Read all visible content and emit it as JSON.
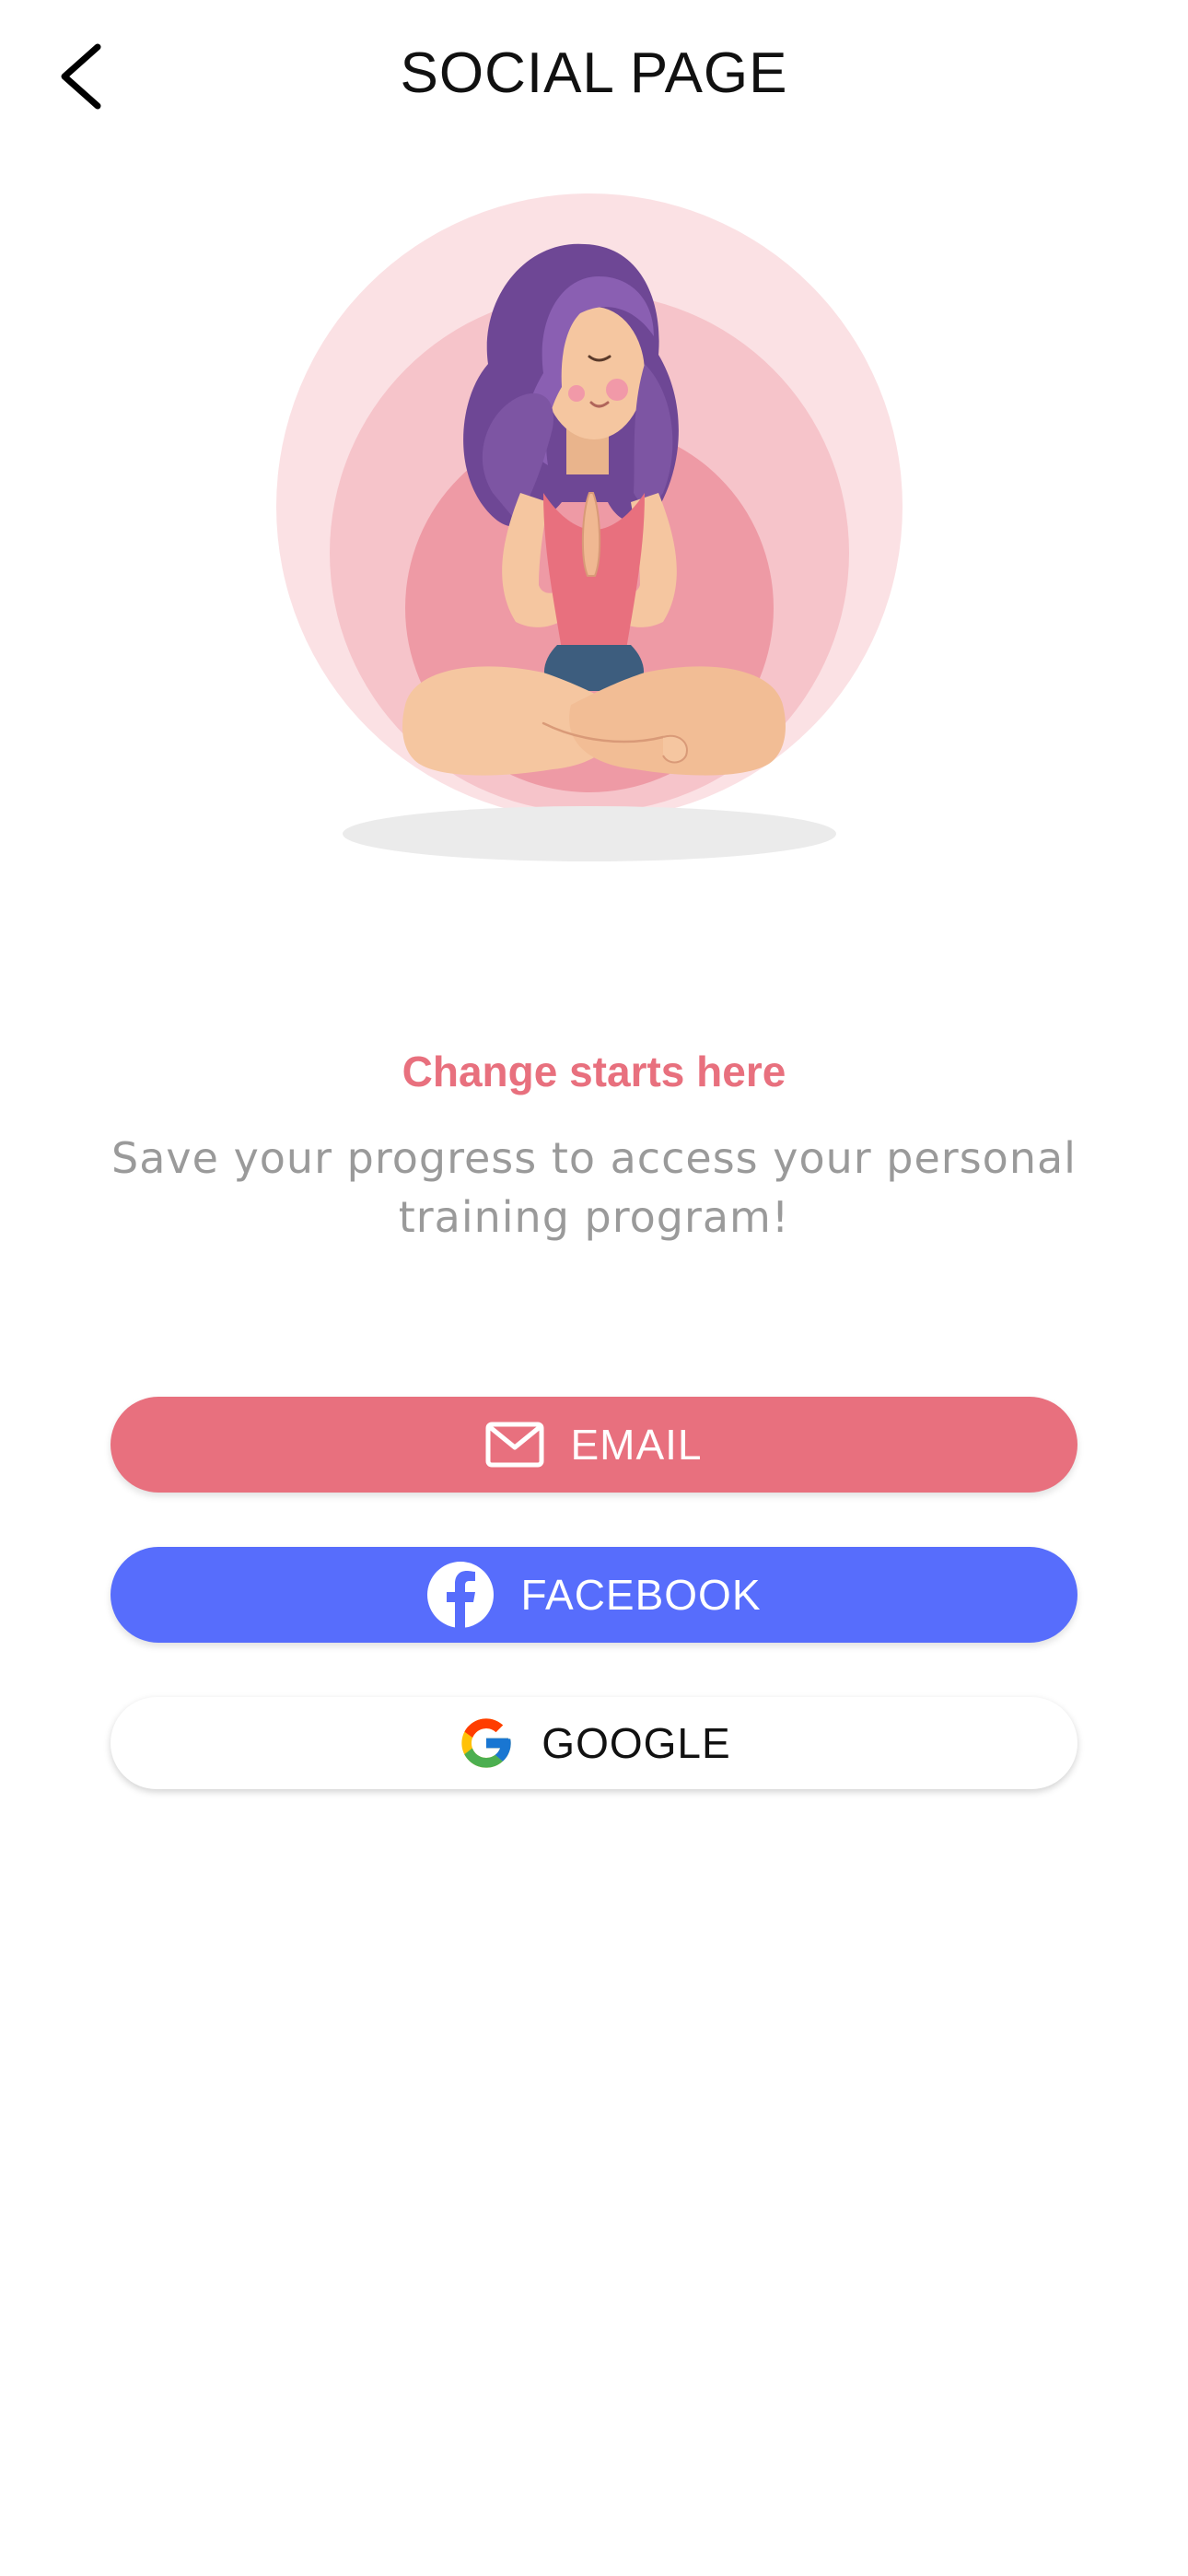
{
  "header": {
    "title": "SOCIAL PAGE",
    "back_icon": "chevron-left-icon"
  },
  "illustration": {
    "subject": "woman-meditating-illustration",
    "colors": {
      "halo_outer": "#fbe1e4",
      "halo_middle": "#f6c4ca",
      "halo_inner": "#ee9aa5",
      "hair": "#7d55a3",
      "skin": "#f5c6a0",
      "top": "#e8707e",
      "shorts": "#3d5d7e"
    }
  },
  "main": {
    "headline": "Change starts here",
    "subtext": "Save your progress to access your personal training program!"
  },
  "buttons": {
    "email": {
      "label": "EMAIL",
      "icon": "envelope-icon",
      "color": "#e8707e"
    },
    "facebook": {
      "label": "FACEBOOK",
      "icon": "facebook-icon",
      "color": "#576dfc"
    },
    "google": {
      "label": "GOOGLE",
      "icon": "google-icon",
      "color": "#ffffff"
    }
  }
}
